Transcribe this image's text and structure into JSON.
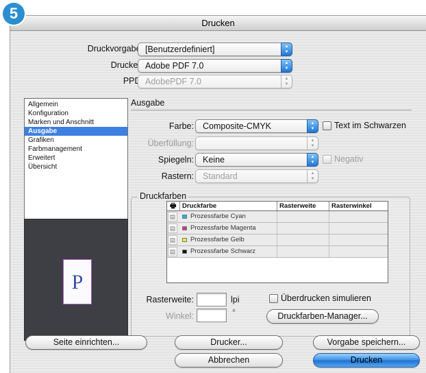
{
  "step_badge": "5",
  "window": {
    "title": "Drucken"
  },
  "top": {
    "druckvorgabe_label": "Druckvorgabe:",
    "druckvorgabe_value": "[Benutzerdefiniert]",
    "drucker_label": "Drucker:",
    "drucker_value": "Adobe PDF 7.0",
    "ppd_label": "PPD:",
    "ppd_value": "AdobePDF 7.0"
  },
  "sidebar": {
    "items": [
      {
        "label": "Allgemein",
        "selected": false
      },
      {
        "label": "Konfiguration",
        "selected": false
      },
      {
        "label": "Marken und Anschnitt",
        "selected": false
      },
      {
        "label": "Ausgabe",
        "selected": true
      },
      {
        "label": "Grafiken",
        "selected": false
      },
      {
        "label": "Farbmanagement",
        "selected": false
      },
      {
        "label": "Erweitert",
        "selected": false
      },
      {
        "label": "Übersicht",
        "selected": false
      }
    ]
  },
  "preview": {
    "glyph": "P"
  },
  "ausgabe": {
    "title": "Ausgabe",
    "farbe_label": "Farbe:",
    "farbe_value": "Composite-CMYK",
    "text_schwarz_label": "Text im Schwarzen",
    "ueberfuellung_label": "Überfüllung:",
    "ueberfuellung_value": "",
    "spiegeln_label": "Spiegeln:",
    "spiegeln_value": "Keine",
    "negativ_label": "Negativ",
    "rastern_label": "Rastern:",
    "rastern_value": "Standard"
  },
  "druckfarben": {
    "title": "Druckfarben",
    "columns": [
      "Druckfarbe",
      "Rasterweite",
      "Rasterwinkel"
    ],
    "rows": [
      {
        "name": "Prozessfarbe Cyan",
        "color": "#1fb3e8"
      },
      {
        "name": "Prozessfarbe Magenta",
        "color": "#d6338c"
      },
      {
        "name": "Prozessfarbe Gelb",
        "color": "#f5e92a"
      },
      {
        "name": "Prozessfarbe Schwarz",
        "color": "#111111"
      }
    ],
    "rasterweite_label": "Rasterweite:",
    "rasterweite_value": "",
    "rasterweite_unit": "lpi",
    "winkel_label": "Winkel:",
    "winkel_value": "",
    "winkel_unit": "°",
    "ueberdrucken_label": "Überdrucken simulieren",
    "manager_button": "Druckfarben-Manager..."
  },
  "buttons": {
    "seite_einrichten": "Seite einrichten...",
    "drucker": "Drucker...",
    "vorgabe_speichern": "Vorgabe speichern...",
    "abbrechen": "Abbrechen",
    "drucken": "Drucken"
  }
}
